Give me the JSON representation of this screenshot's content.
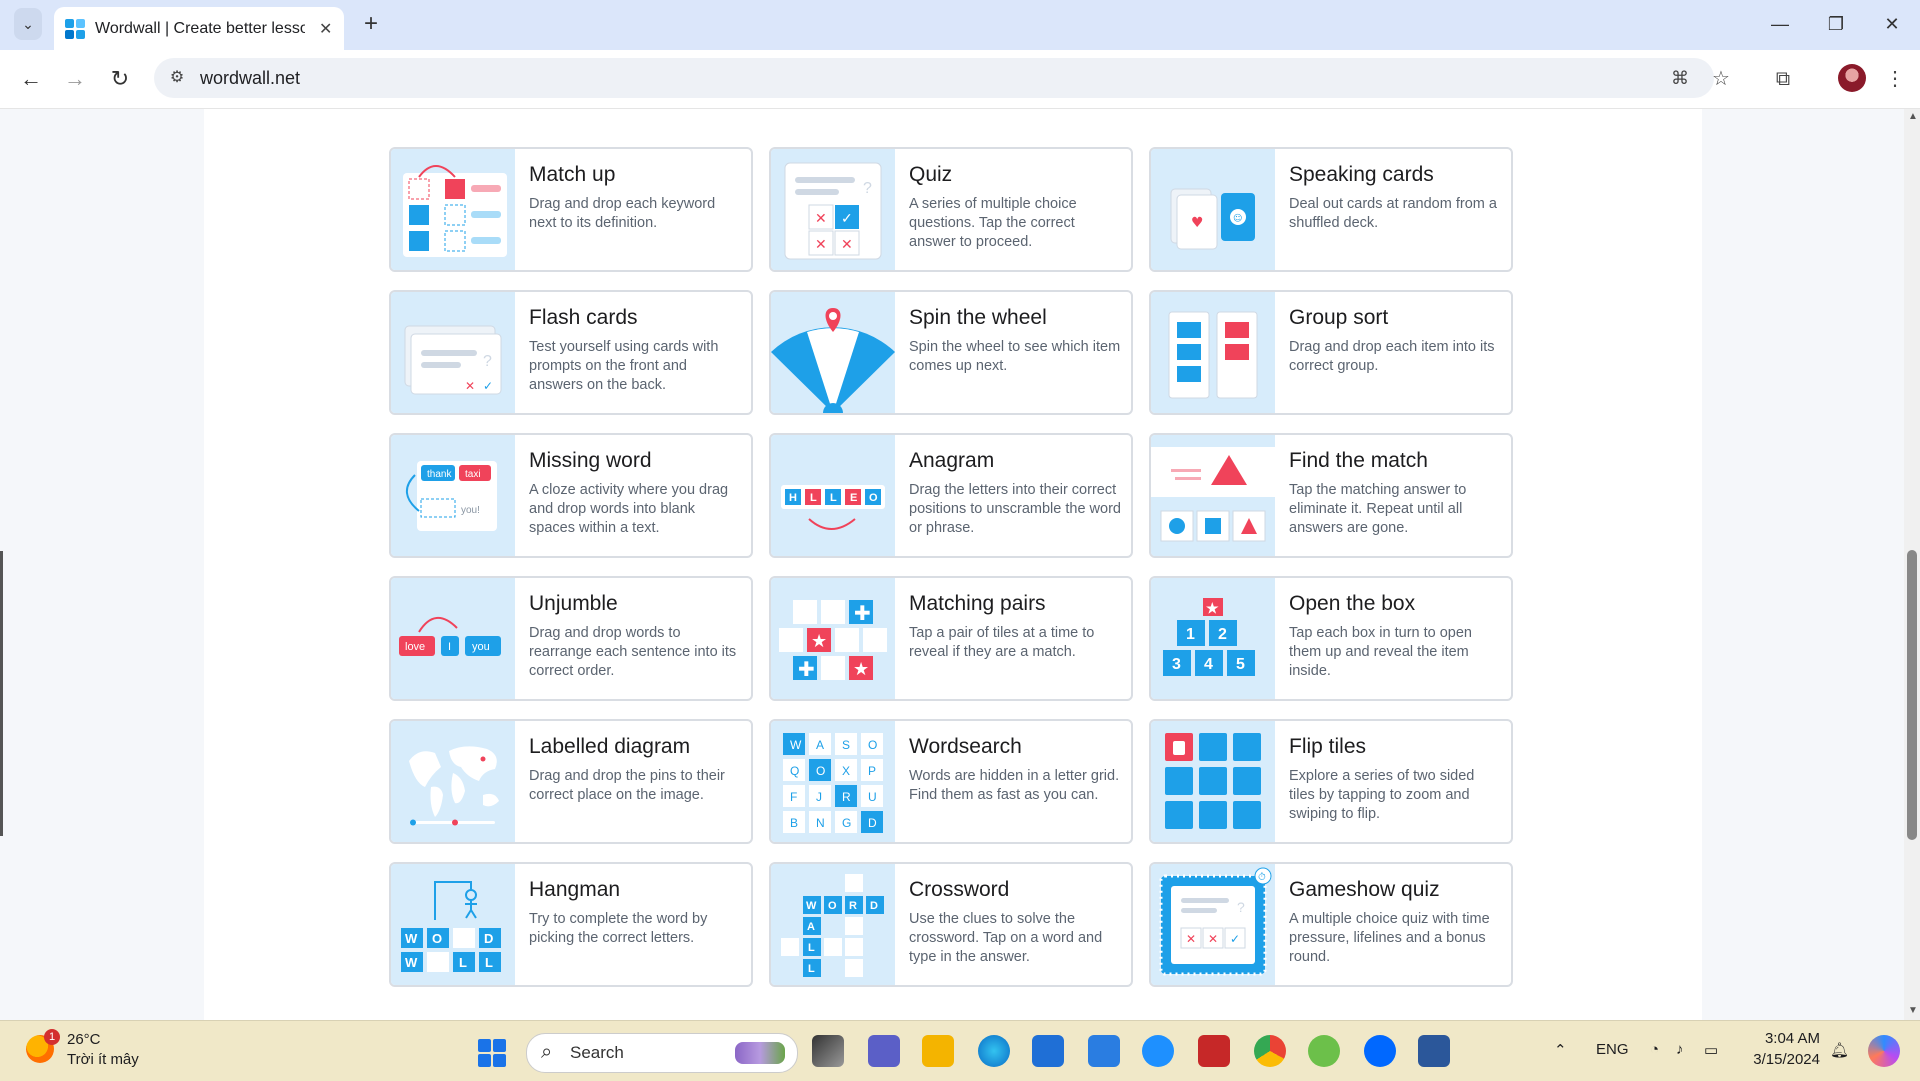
{
  "browser": {
    "tab_title": "Wordwall | Create better lessons quicker",
    "url": "wordwall.net",
    "window_controls": {
      "minimize": "—",
      "restore": "❐",
      "close": "✕"
    }
  },
  "cards": [
    {
      "title": "Match up",
      "desc": "Drag and drop each keyword next to its definition."
    },
    {
      "title": "Quiz",
      "desc": "A series of multiple choice questions. Tap the correct answer to proceed."
    },
    {
      "title": "Speaking cards",
      "desc": "Deal out cards at random from a shuffled deck."
    },
    {
      "title": "Flash cards",
      "desc": "Test yourself using cards with prompts on the front and answers on the back."
    },
    {
      "title": "Spin the wheel",
      "desc": "Spin the wheel to see which item comes up next."
    },
    {
      "title": "Group sort",
      "desc": "Drag and drop each item into its correct group."
    },
    {
      "title": "Missing word",
      "desc": "A cloze activity where you drag and drop words into blank spaces within a text."
    },
    {
      "title": "Anagram",
      "desc": "Drag the letters into their correct positions to unscramble the word or phrase."
    },
    {
      "title": "Find the match",
      "desc": "Tap the matching answer to eliminate it. Repeat until all answers are gone."
    },
    {
      "title": "Unjumble",
      "desc": "Drag and drop words to rearrange each sentence into its correct order."
    },
    {
      "title": "Matching pairs",
      "desc": "Tap a pair of tiles at a time to reveal if they are a match."
    },
    {
      "title": "Open the box",
      "desc": "Tap each box in turn to open them up and reveal the item inside."
    },
    {
      "title": "Labelled diagram",
      "desc": "Drag and drop the pins to their correct place on the image."
    },
    {
      "title": "Wordsearch",
      "desc": "Words are hidden in a letter grid. Find them as fast as you can."
    },
    {
      "title": "Flip tiles",
      "desc": "Explore a series of two sided tiles by tapping to zoom and swiping to flip."
    },
    {
      "title": "Hangman",
      "desc": "Try to complete the word by picking the correct letters."
    },
    {
      "title": "Crossword",
      "desc": "Use the clues to solve the crossword. Tap on a word and type in the answer."
    },
    {
      "title": "Gameshow quiz",
      "desc": "A multiple choice quiz with time pressure, lifelines and a bonus round."
    }
  ],
  "thumb_text": {
    "missing_word": [
      "thank",
      "taxi",
      "you!"
    ],
    "anagram": [
      "H",
      "L",
      "L",
      "E",
      "O"
    ],
    "unjumble": [
      "love",
      "I",
      "you"
    ],
    "open_box": [
      "1",
      "2",
      "3",
      "4",
      "5"
    ],
    "wordsearch": [
      "W",
      "A",
      "S",
      "O",
      "Q",
      "O",
      "X",
      "P",
      "F",
      "J",
      "R",
      "U",
      "B",
      "N",
      "G",
      "D"
    ],
    "hangman": [
      "W",
      "O",
      "D",
      "W",
      "L",
      "L"
    ],
    "crossword": [
      "W",
      "O",
      "R",
      "D",
      "A",
      "L",
      "L"
    ]
  },
  "taskbar": {
    "weather_temp": "26°C",
    "weather_desc": "Trời ít mây",
    "weather_badge": "1",
    "search_label": "Search",
    "lang": "ENG",
    "time": "3:04 AM",
    "date": "3/15/2024"
  },
  "colors": {
    "brand_blue": "#1ea0e8",
    "accent_red": "#f0435a",
    "thumb_bg": "#d7ecfb"
  }
}
